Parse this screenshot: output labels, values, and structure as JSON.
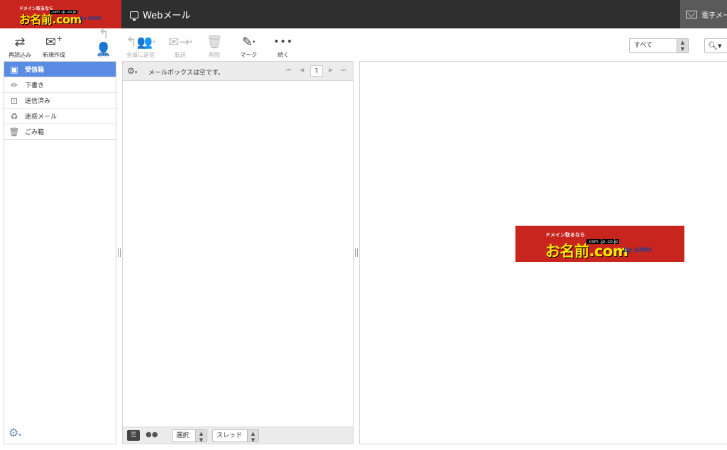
{
  "header": {
    "logo": {
      "small": "ドメイン取るなら",
      "main": "お名前.com",
      "tld": ".com .jp .co.jp",
      "by": "by GMO"
    },
    "title": "Webメール",
    "email_button": "電子メール"
  },
  "toolbar": {
    "reload": "再読込み",
    "compose": "新規作成",
    "reply": "返信",
    "reply_all": "全員に返信",
    "forward": "転送",
    "delete": "削除",
    "mark": "マーク",
    "more": "続く",
    "filter": "すべて"
  },
  "folders": [
    {
      "label": "受信箱",
      "icon": "inbox-icon"
    },
    {
      "label": "下書き",
      "icon": "pencil-icon"
    },
    {
      "label": "送信済み",
      "icon": "sent-icon"
    },
    {
      "label": "迷惑メール",
      "icon": "junk-icon"
    },
    {
      "label": "ごみ箱",
      "icon": "trash-icon"
    }
  ],
  "message_list": {
    "empty_text": "メールボックスは空です。",
    "page": "1",
    "select_label": "選択",
    "thread_label": "スレッド"
  },
  "colors": {
    "brand_red": "#c8251f",
    "active_folder": "#5b8ce3",
    "header_dark": "#2f2f2f"
  }
}
